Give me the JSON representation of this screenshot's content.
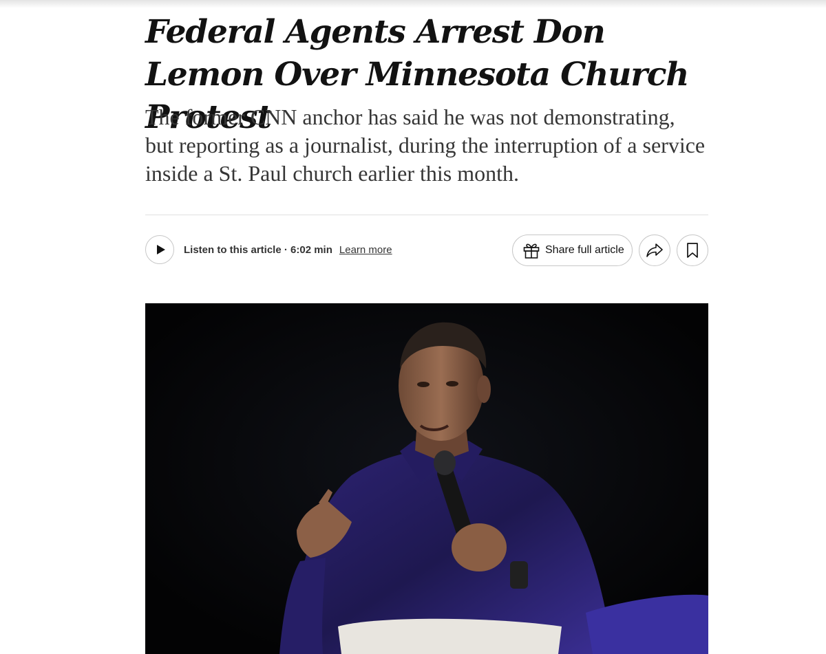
{
  "article": {
    "headline": "Federal Agents Arrest Don Lemon Over Minnesota Church Protest",
    "summary": "The former CNN anchor has said he was not demonstrating, but reporting as a journalist, during the interruption of a service inside a St. Paul church earlier this month."
  },
  "audio": {
    "play_icon": "play-icon",
    "listen_label": "Listen to this article · 6:02 min",
    "learn_more_label": "Learn more"
  },
  "actions": {
    "gift_icon": "gift-icon",
    "share_full_label": "Share full article",
    "share_icon": "share-arrow-icon",
    "bookmark_icon": "bookmark-icon"
  },
  "colors": {
    "text_primary": "#121212",
    "text_summary": "#363636",
    "border": "#c7c7c7",
    "photo_background": "#050608",
    "shirt_accent": "#3a2f8f"
  }
}
